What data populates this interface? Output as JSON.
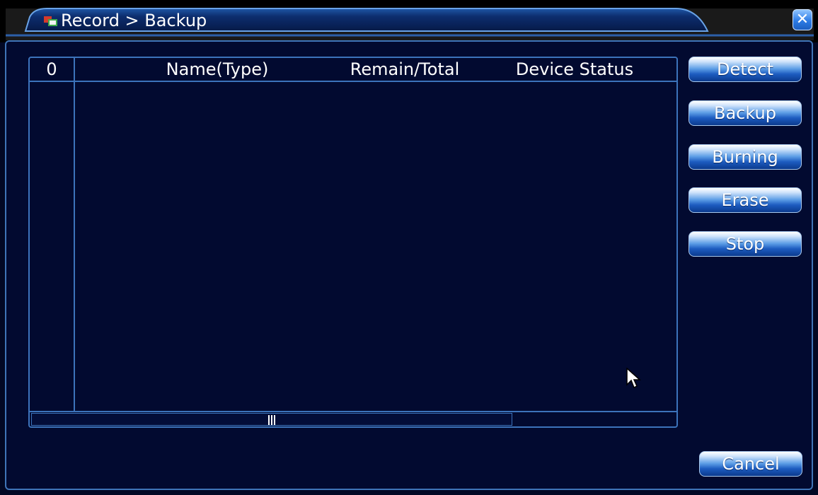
{
  "window": {
    "title": "Record > Backup",
    "icon": "record-backup-icon",
    "close_icon": "close-icon"
  },
  "table": {
    "columns": [
      "0",
      "Name(Type)",
      "Remain/Total",
      "Device Status"
    ],
    "rows": []
  },
  "buttons": {
    "detect": "Detect",
    "backup": "Backup",
    "burning": "Burning",
    "erase": "Erase",
    "stop": "Stop",
    "cancel": "Cancel"
  },
  "colors": {
    "background": "#020a30",
    "border": "#3c73bb",
    "text": "#ffffff"
  }
}
